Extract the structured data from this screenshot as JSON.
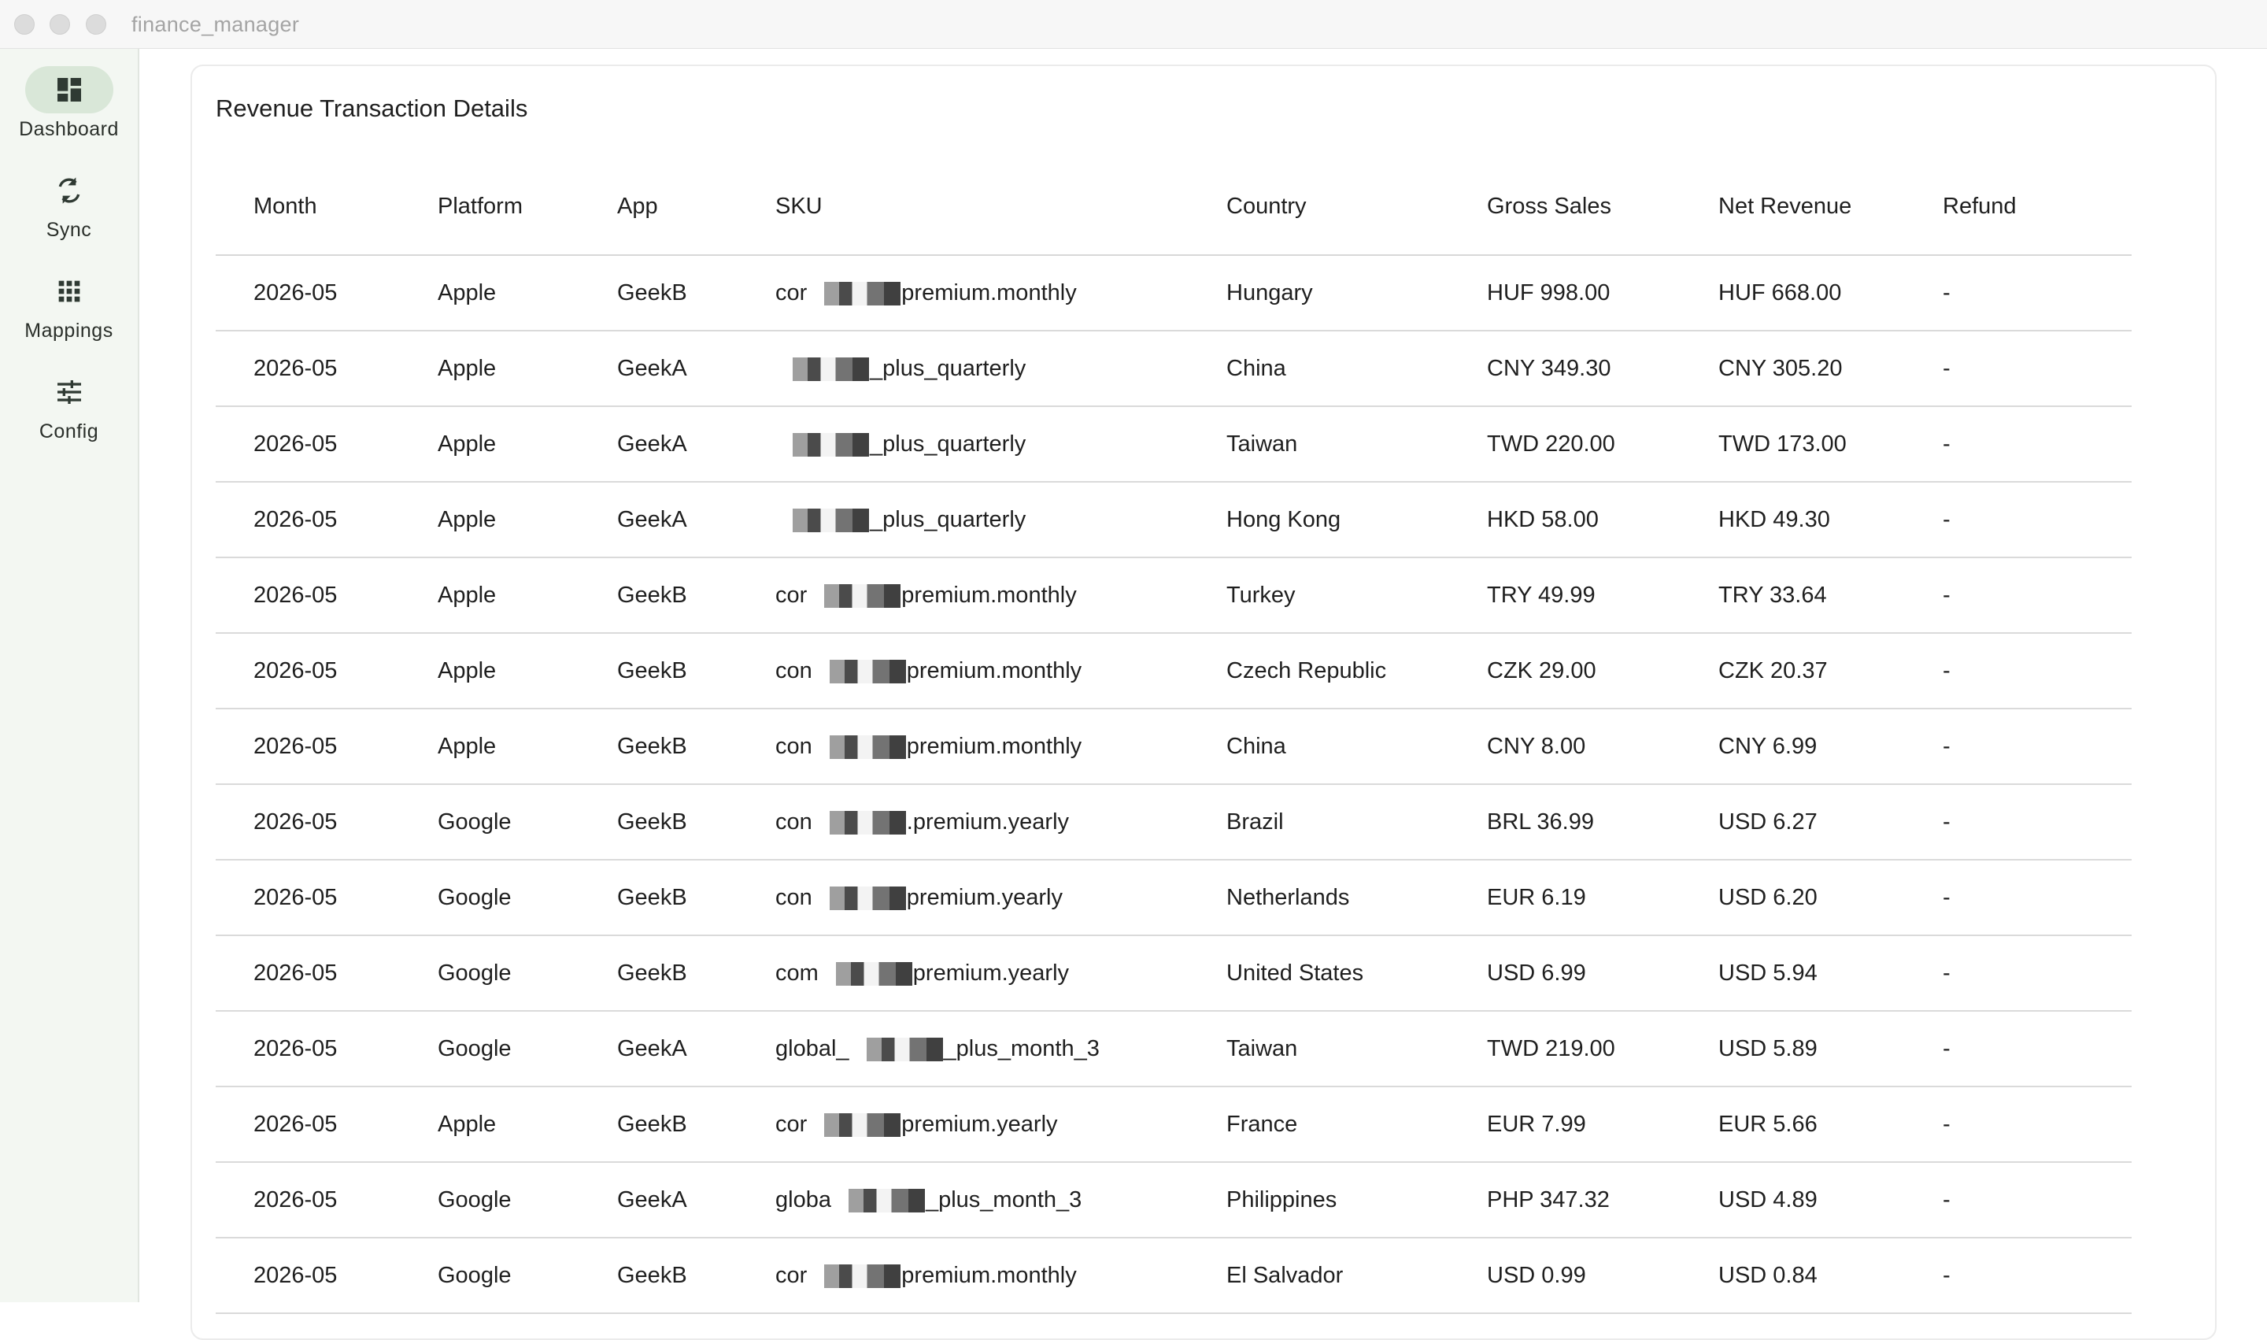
{
  "window": {
    "title": "finance_manager"
  },
  "sidebar": {
    "items": [
      {
        "label": "Dashboard",
        "icon": "dashboard-icon",
        "active": true
      },
      {
        "label": "Sync",
        "icon": "sync-icon",
        "active": false
      },
      {
        "label": "Mappings",
        "icon": "grid-icon",
        "active": false
      },
      {
        "label": "Config",
        "icon": "sliders-icon",
        "active": false
      }
    ]
  },
  "colors": {
    "sidebar_bg": "#f3f7f2",
    "active_pill": "#d9e7d8"
  },
  "main": {
    "title": "Revenue Transaction Details",
    "columns": [
      "Month",
      "Platform",
      "App",
      "SKU",
      "Country",
      "Gross Sales",
      "Net Revenue",
      "Refund"
    ],
    "rows": [
      {
        "month": "2026-05",
        "platform": "Apple",
        "app": "GeekB",
        "sku_prefix": "cor",
        "sku_suffix": "premium.monthly",
        "country": "Hungary",
        "gross": "HUF 998.00",
        "net": "HUF 668.00",
        "refund": "-"
      },
      {
        "month": "2026-05",
        "platform": "Apple",
        "app": "GeekA",
        "sku_prefix": "",
        "sku_suffix": "_plus_quarterly",
        "country": "China",
        "gross": "CNY 349.30",
        "net": "CNY 305.20",
        "refund": "-"
      },
      {
        "month": "2026-05",
        "platform": "Apple",
        "app": "GeekA",
        "sku_prefix": "",
        "sku_suffix": "_plus_quarterly",
        "country": "Taiwan",
        "gross": "TWD 220.00",
        "net": "TWD 173.00",
        "refund": "-"
      },
      {
        "month": "2026-05",
        "platform": "Apple",
        "app": "GeekA",
        "sku_prefix": "",
        "sku_suffix": "_plus_quarterly",
        "country": "Hong Kong",
        "gross": "HKD 58.00",
        "net": "HKD 49.30",
        "refund": "-"
      },
      {
        "month": "2026-05",
        "platform": "Apple",
        "app": "GeekB",
        "sku_prefix": "cor",
        "sku_suffix": "premium.monthly",
        "country": "Turkey",
        "gross": "TRY 49.99",
        "net": "TRY 33.64",
        "refund": "-"
      },
      {
        "month": "2026-05",
        "platform": "Apple",
        "app": "GeekB",
        "sku_prefix": "con",
        "sku_suffix": "premium.monthly",
        "country": "Czech Republic",
        "gross": "CZK 29.00",
        "net": "CZK 20.37",
        "refund": "-"
      },
      {
        "month": "2026-05",
        "platform": "Apple",
        "app": "GeekB",
        "sku_prefix": "con",
        "sku_suffix": "premium.monthly",
        "country": "China",
        "gross": "CNY 8.00",
        "net": "CNY 6.99",
        "refund": "-"
      },
      {
        "month": "2026-05",
        "platform": "Google",
        "app": "GeekB",
        "sku_prefix": "con",
        "sku_suffix": ".premium.yearly",
        "country": "Brazil",
        "gross": "BRL 36.99",
        "net": "USD 6.27",
        "refund": "-"
      },
      {
        "month": "2026-05",
        "platform": "Google",
        "app": "GeekB",
        "sku_prefix": "con",
        "sku_suffix": "premium.yearly",
        "country": "Netherlands",
        "gross": "EUR 6.19",
        "net": "USD 6.20",
        "refund": "-"
      },
      {
        "month": "2026-05",
        "platform": "Google",
        "app": "GeekB",
        "sku_prefix": "com",
        "sku_suffix": "premium.yearly",
        "country": "United States",
        "gross": "USD 6.99",
        "net": "USD 5.94",
        "refund": "-"
      },
      {
        "month": "2026-05",
        "platform": "Google",
        "app": "GeekA",
        "sku_prefix": "global_",
        "sku_suffix": "_plus_month_3",
        "country": "Taiwan",
        "gross": "TWD 219.00",
        "net": "USD 5.89",
        "refund": "-"
      },
      {
        "month": "2026-05",
        "platform": "Apple",
        "app": "GeekB",
        "sku_prefix": "cor",
        "sku_suffix": "premium.yearly",
        "country": "France",
        "gross": "EUR 7.99",
        "net": "EUR 5.66",
        "refund": "-"
      },
      {
        "month": "2026-05",
        "platform": "Google",
        "app": "GeekA",
        "sku_prefix": "globa",
        "sku_suffix": "_plus_month_3",
        "country": "Philippines",
        "gross": "PHP 347.32",
        "net": "USD 4.89",
        "refund": "-"
      },
      {
        "month": "2026-05",
        "platform": "Google",
        "app": "GeekB",
        "sku_prefix": "cor",
        "sku_suffix": "premium.monthly",
        "country": "El Salvador",
        "gross": "USD 0.99",
        "net": "USD 0.84",
        "refund": "-"
      }
    ]
  }
}
